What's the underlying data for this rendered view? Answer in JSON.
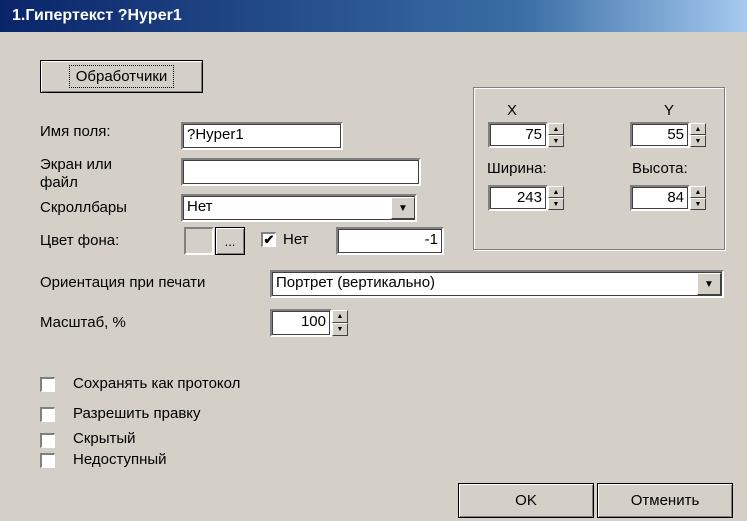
{
  "window": {
    "title": "1.Гипертекст ?Hyper1"
  },
  "handlers_button": "Обработчики",
  "field_name": {
    "label": "Имя поля:",
    "value": "?Hyper1"
  },
  "screen_or_file": {
    "label_line1": "Экран или",
    "label_line2": "файл",
    "value": ""
  },
  "scrollbars": {
    "label": "Скроллбары",
    "value": "Нет"
  },
  "bg_color": {
    "label": "Цвет фона:",
    "browse": "...",
    "none_label": "Нет",
    "none_checked": true,
    "value": "-1"
  },
  "position": {
    "x_label": "X",
    "x_value": "75",
    "y_label": "Y",
    "y_value": "55",
    "width_label": "Ширина:",
    "width_value": "243",
    "height_label": "Высота:",
    "height_value": "84"
  },
  "print_orientation": {
    "label": "Ориентация при печати",
    "value": "Портрет (вертикально)"
  },
  "scale": {
    "label": "Масштаб, %",
    "value": "100"
  },
  "checkboxes": [
    {
      "label": "Сохранять как протокол",
      "checked": false
    },
    {
      "label": "Разрешить правку",
      "checked": false
    },
    {
      "label": "Скрытый",
      "checked": false
    },
    {
      "label": "Недоступный",
      "checked": false
    }
  ],
  "buttons": {
    "ok": "OK",
    "cancel": "Отменить"
  },
  "icons": {
    "checkmark": "✔",
    "spin_up": "▲",
    "spin_down": "▼",
    "dropdown": "▼"
  }
}
